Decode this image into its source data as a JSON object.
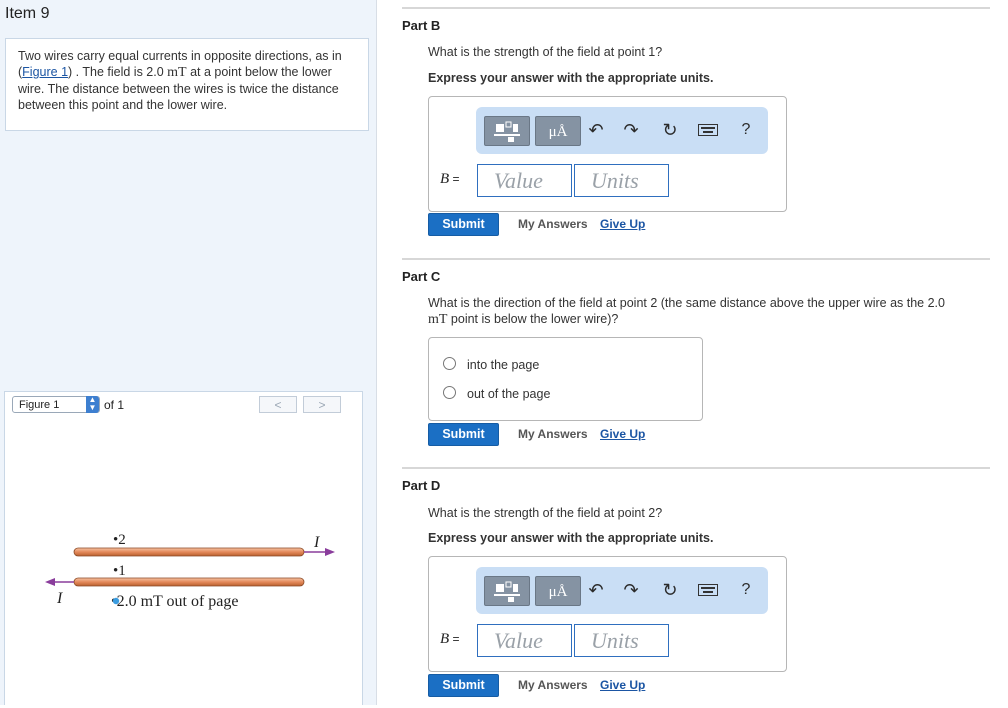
{
  "item_title": "Item 9",
  "problem": {
    "text_1": "Two wires carry equal currents in opposite directions, as in (",
    "figure_link": "Figure 1",
    "text_2": ") . The field is 2.0 ",
    "unit": "mT",
    "text_3": " at a point below the lower wire. The distance between the wires is twice the distance between this point and the lower wire."
  },
  "figure_nav": {
    "selected": "Figure 1",
    "of_label": "of 1",
    "prev": "<",
    "next": ">"
  },
  "figure": {
    "point_2_label": "•2",
    "point_1_label": "•1",
    "current_label_upper": "I",
    "current_label_lower": "I",
    "field_label": "•2.0 mT out of page",
    "wire_color": "#e4895a",
    "arrow_color": "#8a3d9c",
    "point_color": "#3a9ce0"
  },
  "parts": {
    "b": {
      "heading": "Part B",
      "question": "What is the strength of the field at point 1?",
      "instruction": "Express your answer with the appropriate units.",
      "var_label": "B",
      "eq": " =",
      "value_placeholder": "Value",
      "units_placeholder": "Units",
      "submit": "Submit",
      "my_answers": "My Answers",
      "give_up": "Give Up"
    },
    "c": {
      "heading": "Part C",
      "question_1": "What is the direction of the field at point 2 (the same distance above the upper wire as the 2.0",
      "question_unit": "mT",
      "question_2": " point is below the lower wire)?",
      "options": [
        "into the page",
        "out of the page"
      ],
      "submit": "Submit",
      "my_answers": "My Answers",
      "give_up": "Give Up"
    },
    "d": {
      "heading": "Part D",
      "question": "What is the strength of the field at point 2?",
      "instruction": "Express your answer with the appropriate units.",
      "var_label": "B",
      "eq": " =",
      "value_placeholder": "Value",
      "units_placeholder": "Units",
      "submit": "Submit",
      "my_answers": "My Answers",
      "give_up": "Give Up"
    }
  },
  "toolbar": {
    "templates_icon": "templates-icon",
    "units_label": "μÅ",
    "undo_icon": "undo-icon",
    "redo_icon": "redo-icon",
    "reset_icon": "reset-icon",
    "keyboard_icon": "keyboard-icon",
    "help_label": "?"
  }
}
